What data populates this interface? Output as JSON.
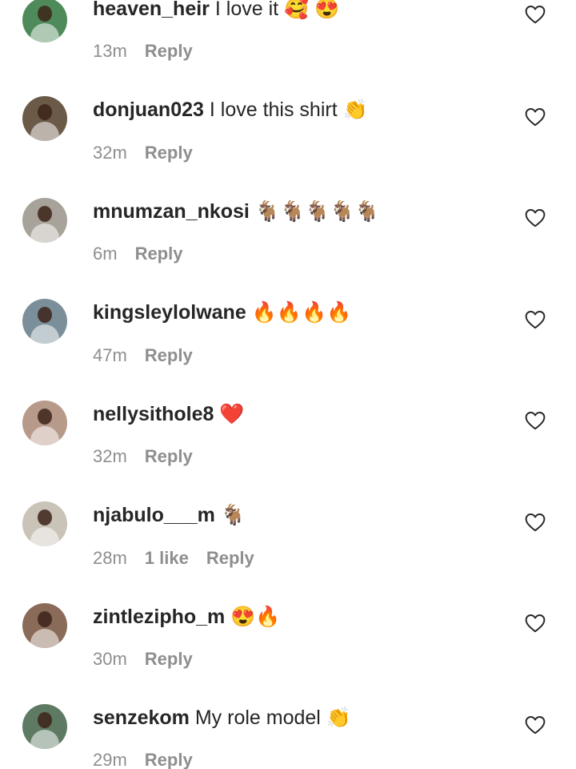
{
  "comments": [
    {
      "username": "heaven_heir",
      "text": "I love it 🥰 😍",
      "time": "13m",
      "likes": "",
      "reply": "Reply",
      "avatar_color": "#4f8a5a"
    },
    {
      "username": "donjuan023",
      "text": "I love this shirt 👏",
      "time": "32m",
      "likes": "",
      "reply": "Reply",
      "avatar_color": "#6b5a48"
    },
    {
      "username": "mnumzan_nkosi",
      "text": "🐐🐐🐐🐐🐐",
      "time": "6m",
      "likes": "",
      "reply": "Reply",
      "avatar_color": "#a8a39a"
    },
    {
      "username": "kingsleylolwane",
      "text": "🔥🔥🔥🔥",
      "time": "47m",
      "likes": "",
      "reply": "Reply",
      "avatar_color": "#7a8f9a"
    },
    {
      "username": "nellysithole8",
      "text": "❤️",
      "time": "32m",
      "likes": "",
      "reply": "Reply",
      "avatar_color": "#b89a8a"
    },
    {
      "username": "njabulo___m",
      "text": "🐐",
      "time": "28m",
      "likes": "1 like",
      "reply": "Reply",
      "avatar_color": "#c9c3b8"
    },
    {
      "username": "zintlezipho_m",
      "text": "😍🔥",
      "time": "30m",
      "likes": "",
      "reply": "Reply",
      "avatar_color": "#8a6a58"
    },
    {
      "username": "senzekom",
      "text": "My role model 👏",
      "time": "29m",
      "likes": "",
      "reply": "Reply",
      "avatar_color": "#5e7a62"
    }
  ],
  "icons": {
    "like": "heart-outline-icon"
  }
}
